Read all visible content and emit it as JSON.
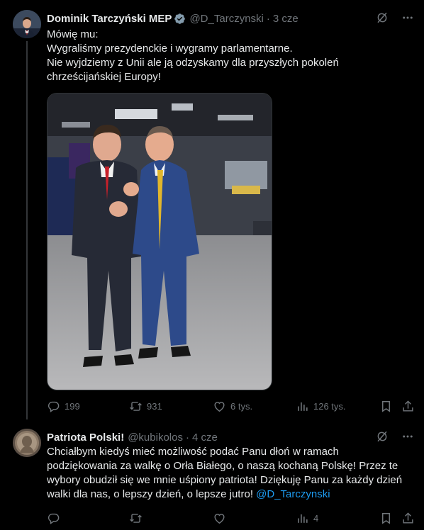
{
  "tweet1": {
    "author_name": "Dominik Tarczyński MEP",
    "handle": "@D_Tarczynski",
    "separator": "·",
    "time": "3 cze",
    "text_lines": [
      "Mówię mu:",
      "Wygraliśmy prezydenckie i wygramy parlamentarne.",
      "Nie wyjdziemy z Unii ale ją odzyskamy dla przyszłych pokoleń",
      "chrześcijańskiej Europy!"
    ],
    "counts": {
      "replies": "199",
      "reposts": "931",
      "likes": "6 tys.",
      "views": "126 tys."
    },
    "icons": {
      "verified": "verified-badge-icon",
      "grok": "grok-icon",
      "more": "more-icon"
    }
  },
  "tweet2": {
    "author_name": "Patriota Polski!",
    "handle": "@kubikolos",
    "separator": "·",
    "time": "4 cze",
    "text_lines": [
      "Chciałbym kiedyś mieć możliwość podać Panu dłoń w ramach",
      "podziękowania za walkę o Orła Białego, o naszą kochaną Polskę! Przez te",
      "wybory obudził się we mnie uśpiony patriota! Dziękuję Panu za każdy dzień",
      "walki dla nas, o lepszy dzień, o lepsze jutro!"
    ],
    "mention": "@D_Tarczynski",
    "counts": {
      "views": "4"
    }
  },
  "colors": {
    "background": "#000000",
    "text": "#e7e9ea",
    "secondary": "#71767b",
    "link": "#1d9bf0",
    "verified": "#829aab"
  }
}
